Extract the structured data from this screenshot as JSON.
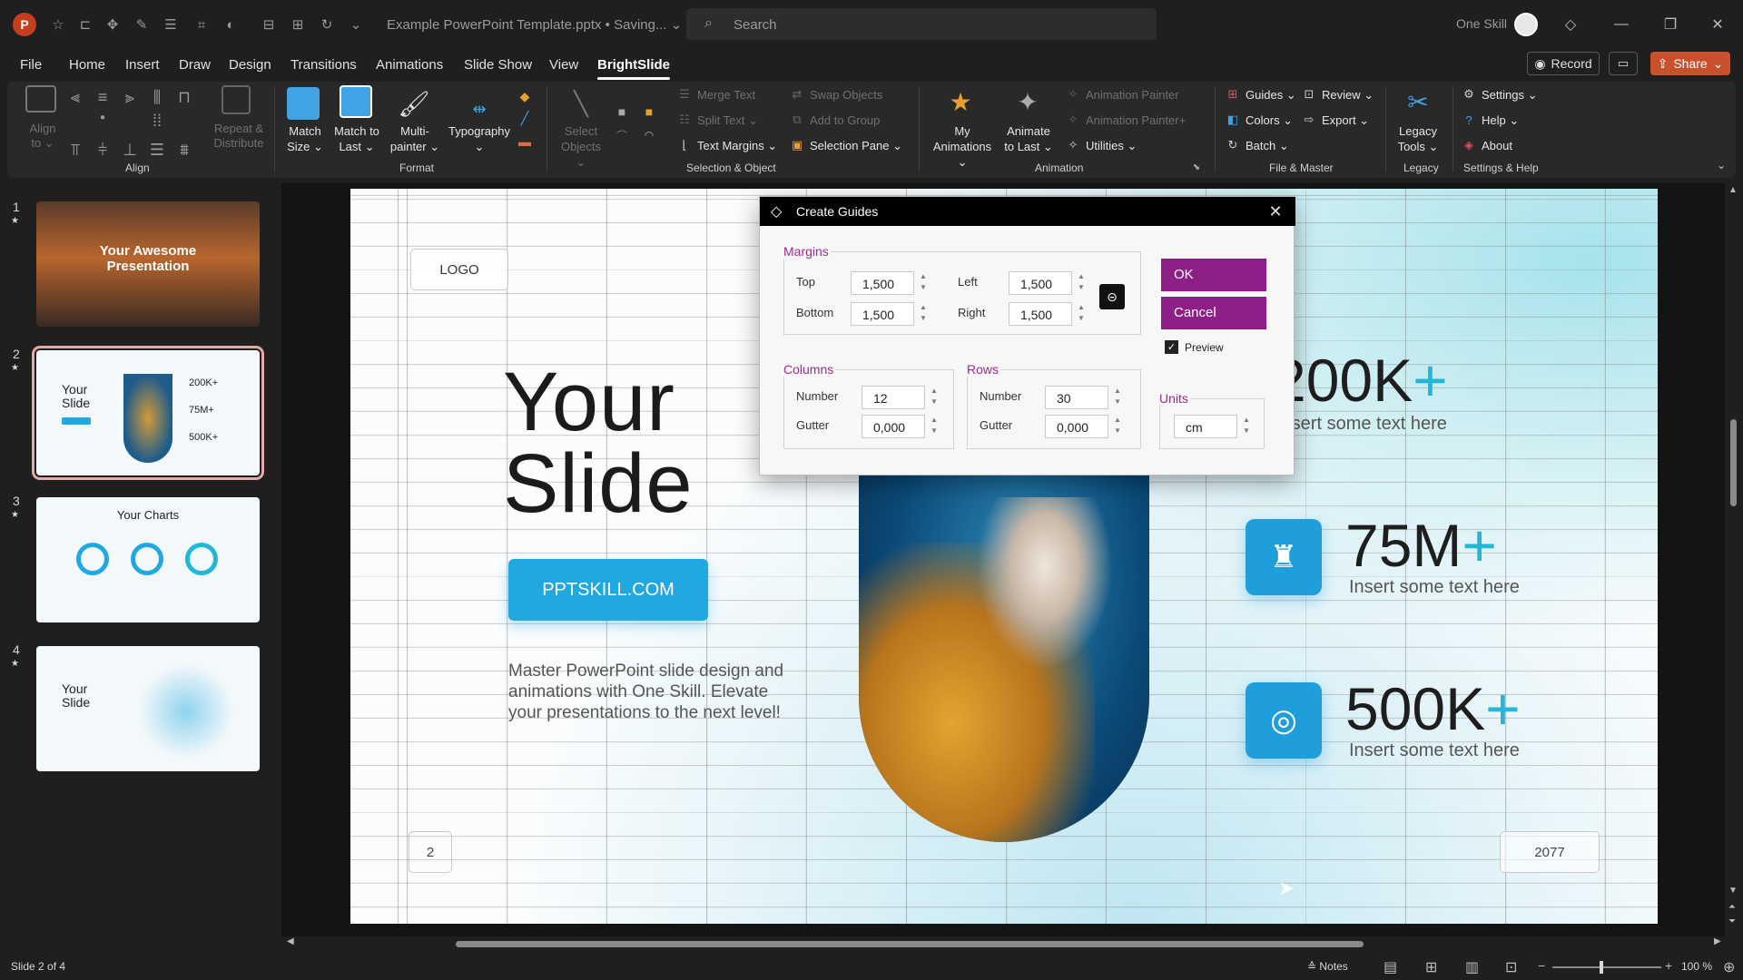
{
  "titlebar": {
    "app_icon": "P",
    "doc_title": "Example PowerPoint Template.pptx • Saving... ⌄",
    "search_placeholder": "Search",
    "user_name": "One Skill",
    "qat_icons": [
      "autosave-icon",
      "shapes-icon",
      "align-icon",
      "nudge-icon",
      "brush-icon",
      "list-icon",
      "crop-icon",
      "fill-icon",
      "dropdown-icon",
      "table-icon",
      "redo-icon",
      "customize-icon"
    ]
  },
  "tabs": [
    "File",
    "Home",
    "Insert",
    "Draw",
    "Design",
    "Transitions",
    "Animations",
    "Slide Show",
    "View",
    "BrightSlide"
  ],
  "active_tab": "BrightSlide",
  "header_buttons": {
    "record": "Record",
    "share": "Share"
  },
  "ribbon": {
    "align": {
      "title": "Align",
      "align_to": "Align to ⌄",
      "repeat": "Repeat & Distribute"
    },
    "format": {
      "title": "Format",
      "match_size": "Match Size ⌄",
      "match_last": "Match to Last ⌄",
      "multi": "Multi- painter ⌄",
      "typography": "Typography ⌄"
    },
    "selection": {
      "title": "Selection & Object",
      "select_objects": "Select Objects ⌄",
      "merge_text": "Merge Text",
      "split_text": "Split Text ⌄",
      "text_margins": "Text Margins ⌄",
      "swap_objects": "Swap Objects",
      "add_group": "Add to Group",
      "selection_pane": "Selection Pane ⌄"
    },
    "animation": {
      "title": "Animation",
      "my_animations": "My Animations ⌄",
      "animate_last": "Animate to Last ⌄",
      "painter": "Animation Painter",
      "painter_plus": "Animation Painter+",
      "utilities": "Utilities ⌄"
    },
    "file_master": {
      "title": "File & Master",
      "guides": "Guides ⌄",
      "colors": "Colors ⌄",
      "batch": "Batch ⌄",
      "review": "Review ⌄",
      "export": "Export ⌄"
    },
    "legacy": {
      "title": "Legacy",
      "legacy_tools": "Legacy Tools ⌄"
    },
    "settings_help": {
      "title": "Settings & Help",
      "settings": "Settings ⌄",
      "help": "Help ⌄",
      "about": "About"
    }
  },
  "thumbnails": [
    {
      "num": "1",
      "title": "Your Awesome Presentation"
    },
    {
      "num": "2",
      "title": "Your Slide",
      "stats": [
        "200K+",
        "75M+",
        "500K+"
      ]
    },
    {
      "num": "3",
      "title": "Your Charts"
    },
    {
      "num": "4",
      "title": "Your Slide"
    }
  ],
  "slide": {
    "logo": "LOGO",
    "title_line1": "Your",
    "title_line2": "Slide",
    "cta": "PPTSKILL.COM",
    "body": "Master PowerPoint slide design and animations with One Skill. Elevate your presentations to the next level!",
    "stats": [
      {
        "value": "200K",
        "plus": "+",
        "sub": "Insert some text here",
        "icon": "chart-icon"
      },
      {
        "value": "75M",
        "plus": "+",
        "sub": "Insert some text here",
        "icon": "chess-icon"
      },
      {
        "value": "500K",
        "plus": "+",
        "sub": "Insert some text here",
        "icon": "target-icon"
      }
    ],
    "page_number": "2",
    "year": "2077"
  },
  "dialog": {
    "title": "Create Guides",
    "margins_label": "Margins",
    "top_label": "Top",
    "top_value": "1,500",
    "bottom_label": "Bottom",
    "bottom_value": "1,500",
    "left_label": "Left",
    "left_value": "1,500",
    "right_label": "Right",
    "right_value": "1,500",
    "columns_label": "Columns",
    "col_number_label": "Number",
    "col_number_value": "12",
    "col_gutter_label": "Gutter",
    "col_gutter_value": "0,000",
    "rows_label": "Rows",
    "row_number_label": "Number",
    "row_number_value": "30",
    "row_gutter_label": "Gutter",
    "row_gutter_value": "0,000",
    "units_label": "Units",
    "units_value": "cm",
    "ok": "OK",
    "cancel": "Cancel",
    "preview_label": "Preview",
    "preview_checked": true
  },
  "statusbar": {
    "slide_count": "Slide 2 of 4",
    "notes": "Notes",
    "zoom": "100 %"
  }
}
